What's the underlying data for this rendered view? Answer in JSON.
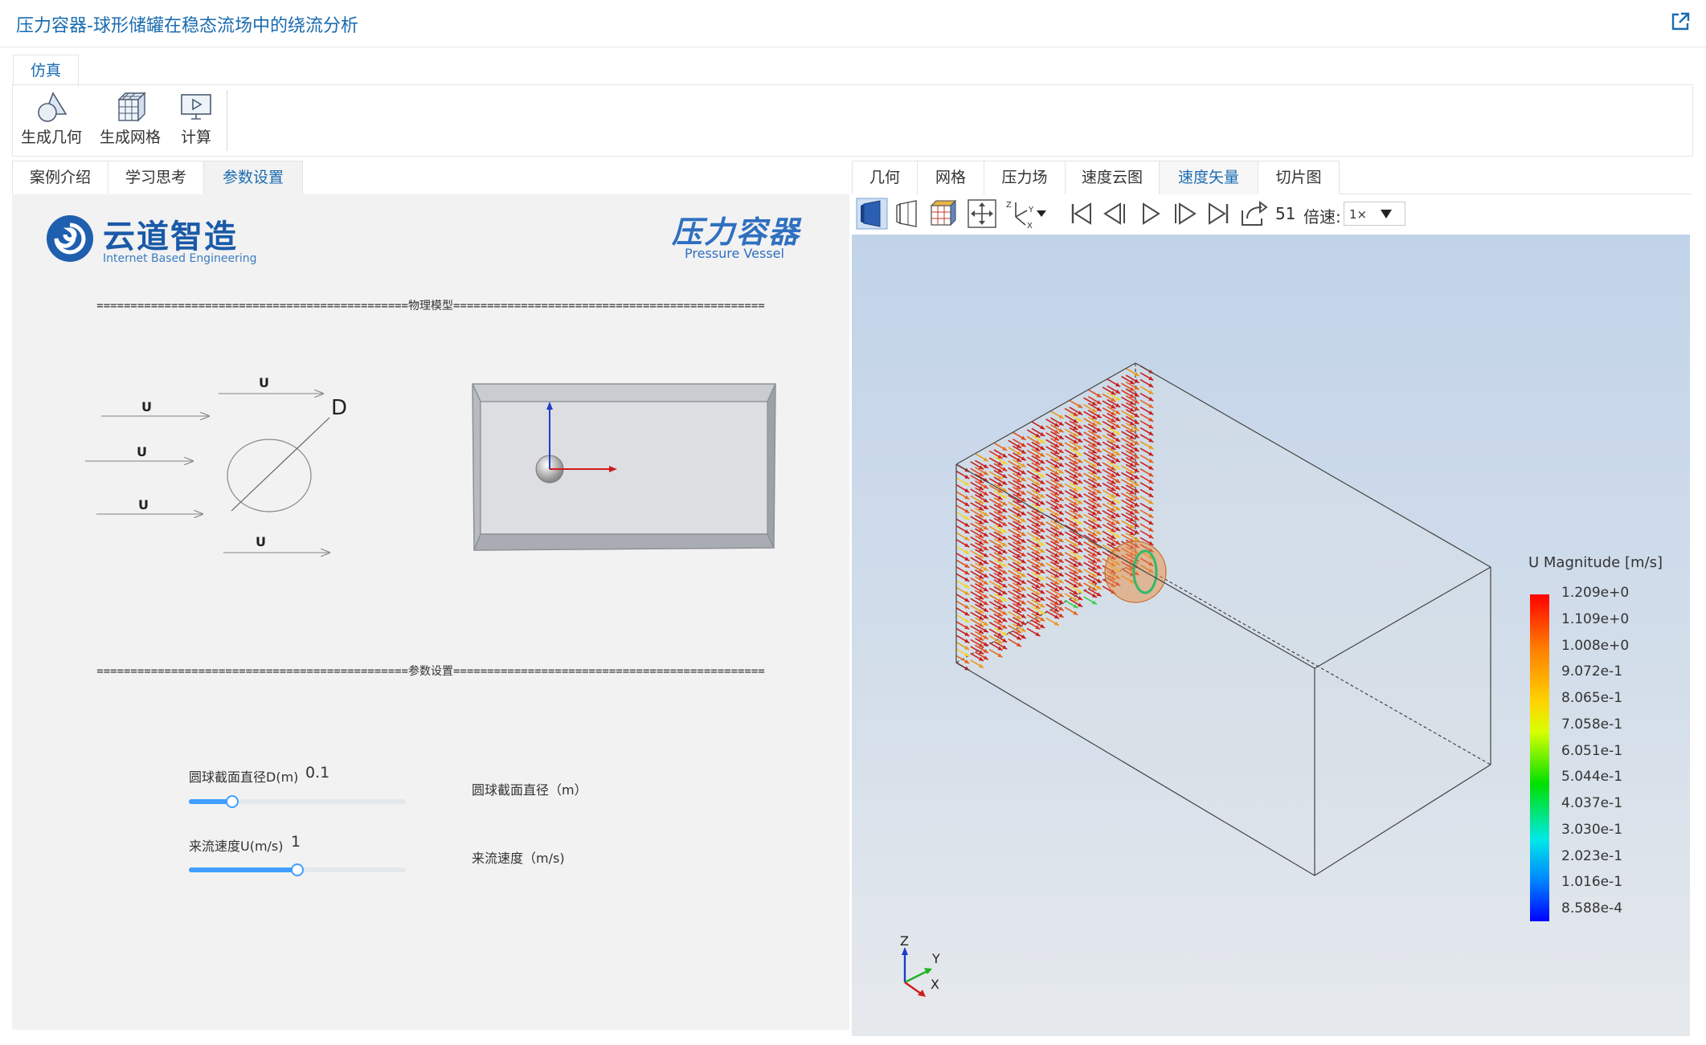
{
  "app": {
    "title": "压力容器-球形储罐在稳态流场中的绕流分析"
  },
  "ribbon": {
    "tab": "仿真",
    "buttons": [
      {
        "label": "生成几何",
        "icon": "geometry-icon"
      },
      {
        "label": "生成网格",
        "icon": "mesh-icon"
      },
      {
        "label": "计算",
        "icon": "compute-icon"
      }
    ]
  },
  "left_tabs": [
    "案例介绍",
    "学习思考",
    "参数设置"
  ],
  "left_active_tab": "参数设置",
  "logo": {
    "cn": "云道智造",
    "en": "Internet Based Engineering"
  },
  "product": {
    "cn": "压力容器",
    "en": "Pressure Vessel"
  },
  "sections": {
    "model_divider": "==============================================物理模型==============================================",
    "params_divider": "==============================================参数设置=============================================="
  },
  "sketch": {
    "u_label": "U",
    "d_label": "D"
  },
  "params": [
    {
      "label": "圆球截面直径D(m)",
      "value": "0.1",
      "description": "圆球截面直径（m）",
      "fraction": 0.2
    },
    {
      "label": "来流速度U(m/s)",
      "value": "1",
      "description": "来流速度（m/s)",
      "fraction": 0.5
    }
  ],
  "right_tabs": [
    "几何",
    "网格",
    "压力场",
    "速度云图",
    "速度矢量",
    "切片图"
  ],
  "right_active_tab": "速度矢量",
  "toolbar": {
    "frame": "51",
    "speed_label": "倍速:",
    "speed_value": "1×",
    "icons": [
      "solid-view-icon",
      "wireframe-view-icon",
      "mesh-view-icon",
      "fit-view-icon",
      "axes-orientation-icon",
      "first-frame-icon",
      "prev-frame-icon",
      "play-icon",
      "next-frame-icon",
      "last-frame-icon",
      "export-icon"
    ]
  },
  "legend": {
    "title": "U Magnitude [m/s]",
    "values": [
      "1.209e+0",
      "1.109e+0",
      "1.008e+0",
      "9.072e-1",
      "8.065e-1",
      "7.058e-1",
      "6.051e-1",
      "5.044e-1",
      "4.037e-1",
      "3.030e-1",
      "2.023e-1",
      "1.016e-1",
      "8.588e-4"
    ]
  },
  "axes": {
    "z": "Z",
    "y": "Y",
    "x": "X"
  },
  "colors": {
    "accent": "#1a6bb0",
    "slider": "#409eff"
  }
}
